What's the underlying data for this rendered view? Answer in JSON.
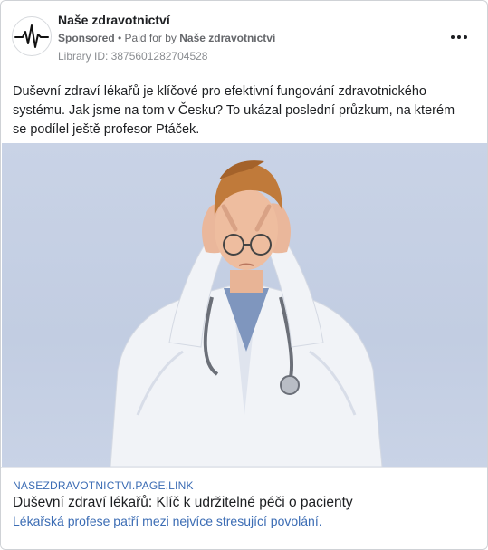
{
  "post": {
    "page_name": "Naše zdravotnictví",
    "sponsored_label": "Sponsored",
    "paid_for_prefix": " • Paid for by ",
    "payer_name": "Naše zdravotnictví",
    "library_id": "Library ID: 3875601282704528",
    "avatar_icon": "heartbeat-line-icon",
    "more_icon": "more-options-icon"
  },
  "body_text": "Duševní zdraví lékařů je klíčové pro efektivní fungování zdravotnického systému. Jak jsme na tom v Česku? To ukázal poslední průzkum, na kterém se podílel ještě profesor Ptáček.",
  "link_preview": {
    "domain": "NASEZDRAVOTNICTVI.PAGE.LINK",
    "title": "Duševní zdraví lékařů: Klíč k udržitelné péči o pacienty",
    "description": "Lékařská profese patří mezi nejvíce stresující povolání."
  },
  "colors": {
    "link_blue": "#3b6cb4",
    "meta_gray": "#65676b",
    "background": "#ffffff"
  }
}
